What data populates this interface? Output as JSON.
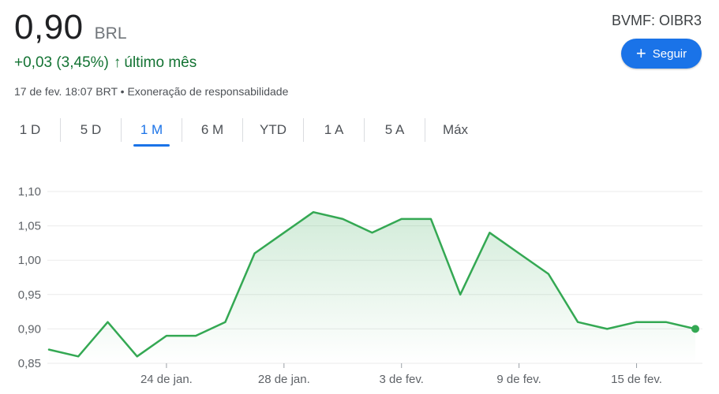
{
  "header": {
    "price": "0,90",
    "currency": "BRL",
    "change": "+0,03 (3,45%)",
    "change_arrow": "↑",
    "period": "último mês",
    "meta": "17 de fev. 18:07 BRT • Exoneração de responsabilidade",
    "ticker": "BVMF: OIBR3",
    "follow_label": "Seguir"
  },
  "tabs": [
    {
      "label": "1 D"
    },
    {
      "label": "5 D"
    },
    {
      "label": "1 M",
      "active": true
    },
    {
      "label": "6 M"
    },
    {
      "label": "YTD"
    },
    {
      "label": "1 A"
    },
    {
      "label": "5 A"
    },
    {
      "label": "Máx"
    }
  ],
  "colors": {
    "line": "#34a853",
    "accent": "#1a73e8",
    "positive": "#137333"
  },
  "chart_data": {
    "type": "area",
    "ylim": [
      0.85,
      1.1
    ],
    "yticks": [
      "0,85",
      "0,90",
      "0,95",
      "1,00",
      "1,05",
      "1,10"
    ],
    "ytick_values": [
      0.85,
      0.9,
      0.95,
      1.0,
      1.05,
      1.1
    ],
    "xtick_labels": [
      "24 de jan.",
      "28 de jan.",
      "3 de fev.",
      "9 de fev.",
      "15 de fev."
    ],
    "xtick_index": [
      4,
      8,
      12,
      16,
      20
    ],
    "series": [
      {
        "values": [
          0.87,
          0.86,
          0.91,
          0.86,
          0.89,
          0.89,
          0.91,
          1.01,
          1.04,
          1.07,
          1.06,
          1.04,
          1.06,
          1.06,
          0.95,
          1.04,
          1.01,
          0.98,
          0.91,
          0.9,
          0.91,
          0.91,
          0.9
        ]
      }
    ],
    "grid": true,
    "last_point_marker": true
  }
}
